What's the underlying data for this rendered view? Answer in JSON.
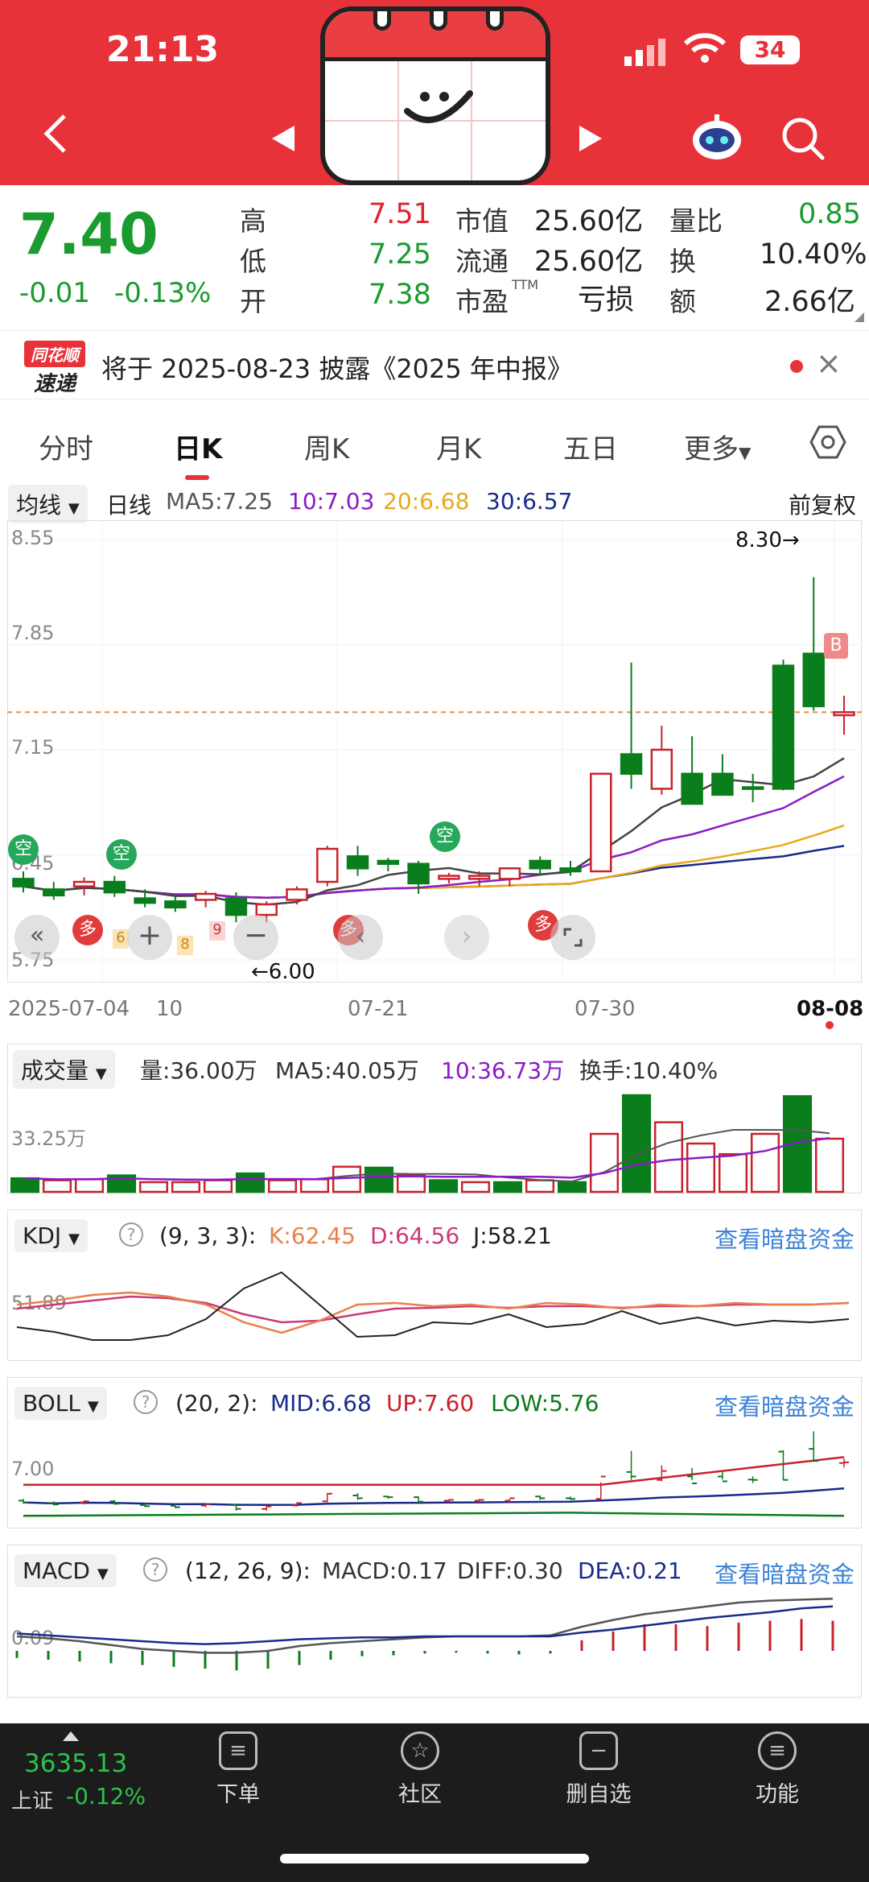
{
  "status": {
    "time": "21:13",
    "battery": "34"
  },
  "header": {
    "back_glyph": "‹",
    "prev_glyph": "◀",
    "next_glyph": "▶"
  },
  "quote": {
    "price": "7.40",
    "change": "-0.01",
    "change_pct": "-0.13%",
    "stats": [
      {
        "label": "高",
        "value": "7.51",
        "color": "red"
      },
      {
        "label": "低",
        "value": "7.25",
        "color": "green"
      },
      {
        "label": "开",
        "value": "7.38",
        "color": "green"
      }
    ],
    "mid": [
      {
        "label": "市值",
        "value": "25.60亿"
      },
      {
        "label": "流通",
        "value": "25.60亿"
      },
      {
        "label": "市盈",
        "sup": "TTM",
        "value": "亏损"
      }
    ],
    "right": [
      {
        "label": "量比",
        "value": "0.85",
        "color": "green"
      },
      {
        "label": "换",
        "value": "10.40%",
        "color": "dark"
      },
      {
        "label": "额",
        "value": "2.66亿",
        "color": "dark"
      }
    ]
  },
  "notice": {
    "brand_top": "同花顺",
    "brand_bottom": "速递",
    "text": "将于 2025-08-23 披露《2025 年中报》",
    "close": "×"
  },
  "tabs": [
    "分时",
    "日K",
    "周K",
    "月K",
    "五日",
    "更多"
  ],
  "active_tab": 1,
  "ma_legend": {
    "dropdown": "均线",
    "period": "日线",
    "ma5": "MA5:7.25",
    "ma10": "10:7.03",
    "ma20": "20:6.68",
    "ma30": "30:6.57",
    "adjust": "前复权"
  },
  "kline": {
    "y_ticks": [
      "8.55",
      "7.85",
      "7.15",
      "6.45",
      "5.75"
    ],
    "high_marker": "8.30→",
    "low_marker": "←6.00",
    "dates": [
      "2025-07-04",
      "10",
      "07-21",
      "07-30",
      "08-08"
    ],
    "tag_kong": "空",
    "tag_duo": "多",
    "tag_b": "B",
    "small_tags": [
      "6",
      "8",
      "9"
    ]
  },
  "chart_data": {
    "type": "candlestick",
    "ylim": [
      5.75,
      8.55
    ],
    "candles": [
      [
        6.29,
        6.34,
        6.2,
        6.24
      ],
      [
        6.22,
        6.27,
        6.15,
        6.18
      ],
      [
        6.24,
        6.3,
        6.18,
        6.27
      ],
      [
        6.27,
        6.31,
        6.17,
        6.2
      ],
      [
        6.16,
        6.22,
        6.1,
        6.13
      ],
      [
        6.14,
        6.19,
        6.07,
        6.1
      ],
      [
        6.15,
        6.21,
        6.1,
        6.19
      ],
      [
        6.16,
        6.2,
        6.0,
        6.05
      ],
      [
        6.05,
        6.14,
        6.0,
        6.12
      ],
      [
        6.15,
        6.24,
        6.12,
        6.22
      ],
      [
        6.27,
        6.51,
        6.24,
        6.49
      ],
      [
        6.44,
        6.51,
        6.31,
        6.36
      ],
      [
        6.41,
        6.43,
        6.34,
        6.39
      ],
      [
        6.39,
        6.41,
        6.19,
        6.26
      ],
      [
        6.29,
        6.33,
        6.26,
        6.31
      ],
      [
        6.29,
        6.34,
        6.24,
        6.31
      ],
      [
        6.29,
        6.34,
        6.24,
        6.36
      ],
      [
        6.41,
        6.44,
        6.31,
        6.36
      ],
      [
        6.36,
        6.41,
        6.31,
        6.34
      ],
      [
        6.34,
        6.82,
        6.34,
        6.99
      ],
      [
        7.12,
        7.73,
        6.89,
        6.99
      ],
      [
        6.89,
        7.31,
        6.85,
        7.15
      ],
      [
        6.99,
        7.24,
        6.88,
        6.79
      ],
      [
        6.99,
        7.12,
        6.9,
        6.85
      ],
      [
        6.9,
        6.99,
        6.8,
        6.89
      ],
      [
        7.71,
        7.75,
        6.88,
        6.89
      ],
      [
        7.79,
        8.3,
        7.41,
        7.44
      ],
      [
        7.38,
        7.51,
        7.25,
        7.4
      ]
    ],
    "ma5": "7.25",
    "ma10": "7.03",
    "ma20": "6.68",
    "ma30": "6.57"
  },
  "volume": {
    "dropdown": "成交量",
    "vol": "量:36.00万",
    "ma5": "MA5:40.05万",
    "ma10": "10:36.73万",
    "turnover": "换手:10.40%",
    "y_label": "33.25万",
    "bars": [
      {
        "v": 0.14,
        "up": false
      },
      {
        "v": 0.12,
        "up": true
      },
      {
        "v": 0.13,
        "up": true
      },
      {
        "v": 0.17,
        "up": false
      },
      {
        "v": 0.1,
        "up": true
      },
      {
        "v": 0.1,
        "up": true
      },
      {
        "v": 0.12,
        "up": true
      },
      {
        "v": 0.19,
        "up": false
      },
      {
        "v": 0.12,
        "up": true
      },
      {
        "v": 0.13,
        "up": true
      },
      {
        "v": 0.26,
        "up": true
      },
      {
        "v": 0.25,
        "up": false
      },
      {
        "v": 0.17,
        "up": true
      },
      {
        "v": 0.12,
        "up": false
      },
      {
        "v": 0.1,
        "up": true
      },
      {
        "v": 0.1,
        "up": false
      },
      {
        "v": 0.12,
        "up": true
      },
      {
        "v": 0.1,
        "up": false
      },
      {
        "v": 0.6,
        "up": true
      },
      {
        "v": 1.0,
        "up": false
      },
      {
        "v": 0.72,
        "up": true
      },
      {
        "v": 0.5,
        "up": true
      },
      {
        "v": 0.39,
        "up": true
      },
      {
        "v": 0.6,
        "up": true
      },
      {
        "v": 0.99,
        "up": false
      },
      {
        "v": 0.55,
        "up": true
      }
    ]
  },
  "kdj": {
    "dropdown": "KDJ",
    "params": "(9, 3, 3):",
    "k": "K:62.45",
    "d": "D:64.56",
    "j": "J:58.21",
    "y_label": "51.89",
    "link": "查看暗盘资金"
  },
  "boll": {
    "dropdown": "BOLL",
    "params": "(20, 2):",
    "mid": "MID:6.68",
    "up": "UP:7.60",
    "low": "LOW:5.76",
    "y_label": "7.00",
    "link": "查看暗盘资金"
  },
  "macd": {
    "dropdown": "MACD",
    "params": "(12, 26, 9):",
    "macd": "MACD:0.17",
    "diff": "DIFF:0.30",
    "dea": "DEA:0.21",
    "y_label": "0.09",
    "link": "查看暗盘资金"
  },
  "index": {
    "value": "3635.13",
    "name": "上证",
    "change": "-0.12%"
  },
  "bottom_nav": [
    {
      "label": "下单",
      "icon": "order-icon"
    },
    {
      "label": "社区",
      "icon": "community-icon"
    },
    {
      "label": "删自选",
      "icon": "remove-watchlist-icon"
    },
    {
      "label": "功能",
      "icon": "menu-icon"
    }
  ],
  "colors": {
    "header": "#e8323a",
    "up": "#c8232c",
    "down": "#0a7d1d",
    "ma5": "#444444",
    "ma10": "#8b1cc7",
    "ma20": "#e8a91a",
    "ma30": "#1a2a8a"
  }
}
